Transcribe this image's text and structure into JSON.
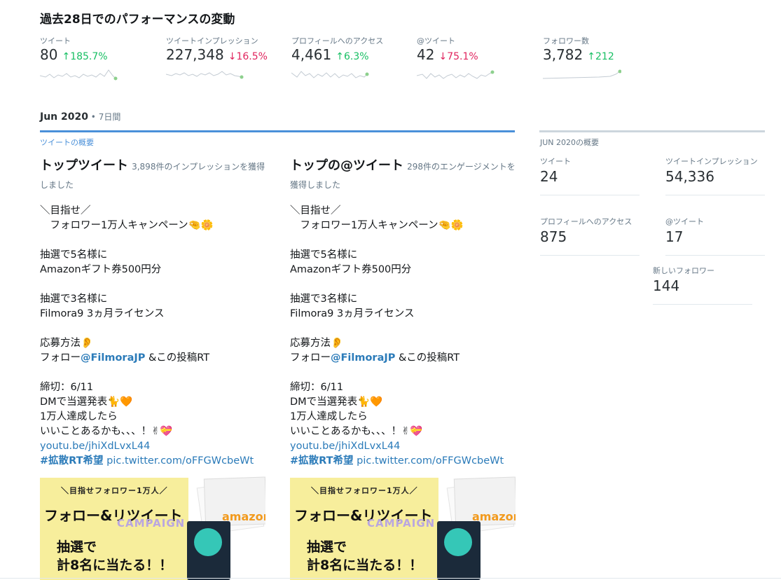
{
  "header": {
    "title": "過去28日でのパフォーマンスの変動"
  },
  "metrics": [
    {
      "label": "ツイート",
      "value": "80",
      "change": "185.7%",
      "direction": "up"
    },
    {
      "label": "ツイートインプレッション",
      "value": "227,348",
      "change": "16.5%",
      "direction": "down"
    },
    {
      "label": "プロフィールへのアクセス",
      "value": "4,461",
      "change": "6.3%",
      "direction": "up"
    },
    {
      "label": "@ツイート",
      "value": "42",
      "change": "75.1%",
      "direction": "down"
    },
    {
      "label": "フォロワー数",
      "value": "3,782",
      "change": "212",
      "direction": "up"
    }
  ],
  "period": {
    "month": "Jun 2020",
    "sub": " • 7日間"
  },
  "tab": {
    "label": "ツイートの概要"
  },
  "top_tweet": {
    "heading": "トップツイート",
    "sub": "3,898件のインプレッションを獲得しました"
  },
  "top_mention": {
    "heading": "トップの@ツイート",
    "sub": "298件のエンゲージメントを獲得しました"
  },
  "tweet": {
    "l1": "＼目指せ／",
    "l2": "　フォロワー1万人キャンペーン🤏🌼",
    "l3": "抽選で5名様に",
    "l4": "Amazonギフト券500円分",
    "l5": "抽選で3名様に",
    "l6": "Filmora9 3ヵ月ライセンス",
    "l7": "応募方法👂",
    "l8a": "フォロー",
    "l8b": "@FilmoraJP",
    "l8c": " &この投稿RT",
    "l9": "締切：6/11",
    "l10": "DMで当選発表🐈🧡",
    "l11": "1万人達成したら",
    "l12": "いいことあるかも、、、！✌💝",
    "l13": "youtu.be/jhiXdLvxL44",
    "l14a": "#拡散RT希望",
    "l14b": " pic.twitter.com/oFFGWcbeWt"
  },
  "image": {
    "line1": "＼目指せフォロワー1万人／",
    "line2": "フォロー&リツイート",
    "line3": "CAMPAIGN",
    "line4": "抽選で",
    "line5": "計8名に当たる！！",
    "amazon": "amazon"
  },
  "summary": {
    "title": "JUN 2020の概要",
    "tweets": {
      "label": "ツイート",
      "value": "24"
    },
    "impressions": {
      "label": "ツイートインプレッション",
      "value": "54,336"
    },
    "profile": {
      "label": "プロフィールへのアクセス",
      "value": "875"
    },
    "mentions": {
      "label": "@ツイート",
      "value": "17"
    },
    "followers": {
      "label": "新しいフォロワー",
      "value": "144"
    }
  },
  "colors": {
    "up": "#17bf63",
    "down": "#e0245e",
    "accent": "#4a90d9",
    "link": "#2b7bb9"
  }
}
